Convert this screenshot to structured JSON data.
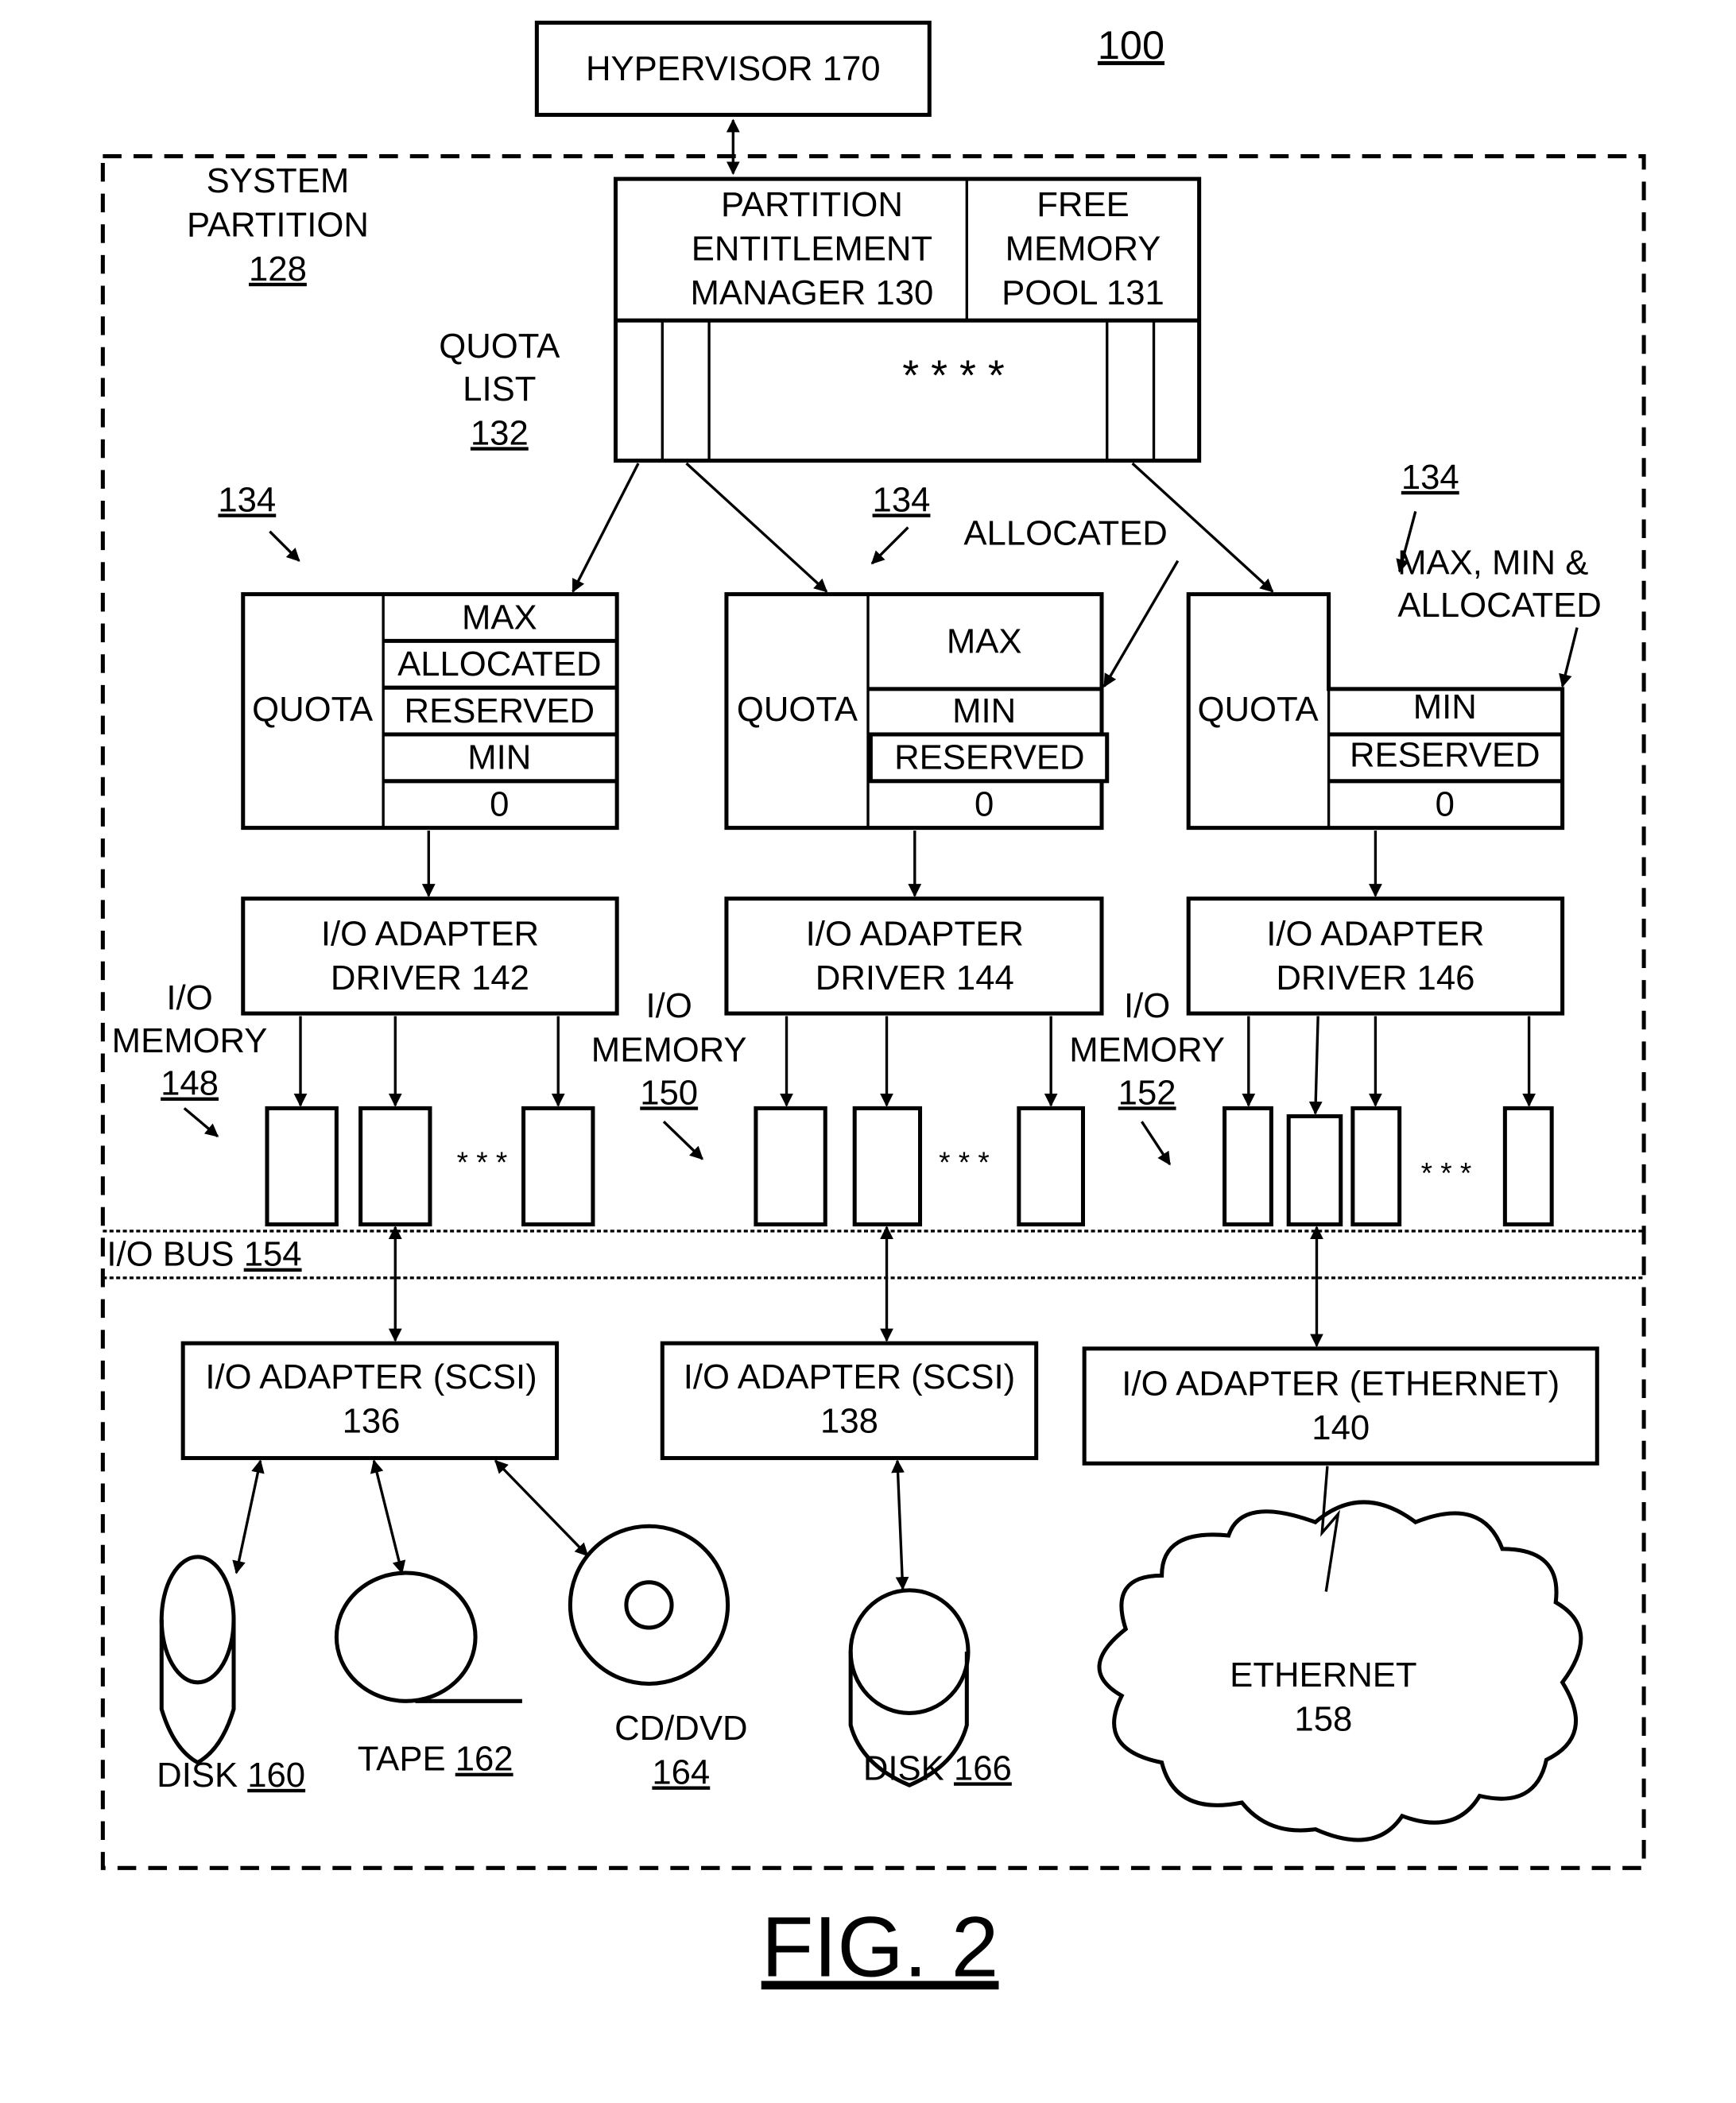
{
  "figure": {
    "number_label": "100",
    "caption": "FIG. 2"
  },
  "hypervisor": {
    "label": "HYPERVISOR 170"
  },
  "system_partition": {
    "line1": "SYSTEM",
    "line2": "PARTITION",
    "ref": "128"
  },
  "pem": {
    "line1": "PARTITION",
    "line2": "ENTITLEMENT",
    "line3": "MANAGER 130"
  },
  "free_pool": {
    "line1": "FREE",
    "line2": "MEMORY",
    "line3": "POOL 131"
  },
  "quota_list": {
    "line1": "QUOTA",
    "line2": "LIST",
    "ref": "132",
    "ellipsis": "* * * *"
  },
  "quota_ref": "134",
  "annotations": {
    "allocated": "ALLOCATED",
    "max_min_alloc_1": "MAX, MIN &",
    "max_min_alloc_2": "ALLOCATED"
  },
  "quotas": [
    {
      "title": "QUOTA",
      "rows": [
        "MAX",
        "ALLOCATED",
        "RESERVED",
        "MIN",
        "0"
      ]
    },
    {
      "title": "QUOTA",
      "rows": [
        "MAX",
        "MIN",
        "RESERVED",
        "0"
      ]
    },
    {
      "title": "QUOTA",
      "rows": [
        "MIN",
        "RESERVED",
        "0"
      ]
    }
  ],
  "drivers": [
    {
      "line1": "I/O ADAPTER",
      "line2": "DRIVER 142"
    },
    {
      "line1": "I/O ADAPTER",
      "line2": "DRIVER 144"
    },
    {
      "line1": "I/O ADAPTER",
      "line2": "DRIVER 146"
    }
  ],
  "io_memory": [
    {
      "line1": "I/O",
      "line2": "MEMORY",
      "ref": "148"
    },
    {
      "line1": "I/O",
      "line2": "MEMORY",
      "ref": "150"
    },
    {
      "line1": "I/O",
      "line2": "MEMORY",
      "ref": "152"
    }
  ],
  "ellipsis_small": "* * *",
  "io_bus": {
    "label": "I/O BUS",
    "ref": "154"
  },
  "adapters": [
    {
      "line1": "I/O ADAPTER (SCSI)",
      "line2": "136"
    },
    {
      "line1": "I/O ADAPTER (SCSI)",
      "line2": "138"
    },
    {
      "line1": "I/O ADAPTER (ETHERNET)",
      "line2": "140"
    }
  ],
  "devices": {
    "disk160": {
      "label": "DISK",
      "ref": "160"
    },
    "tape162": {
      "label": "TAPE",
      "ref": "162"
    },
    "cd164": {
      "label": "CD/DVD",
      "ref": "164"
    },
    "disk166": {
      "label": "DISK",
      "ref": "166"
    },
    "ethernet158": {
      "line1": "ETHERNET",
      "line2": "158"
    }
  }
}
